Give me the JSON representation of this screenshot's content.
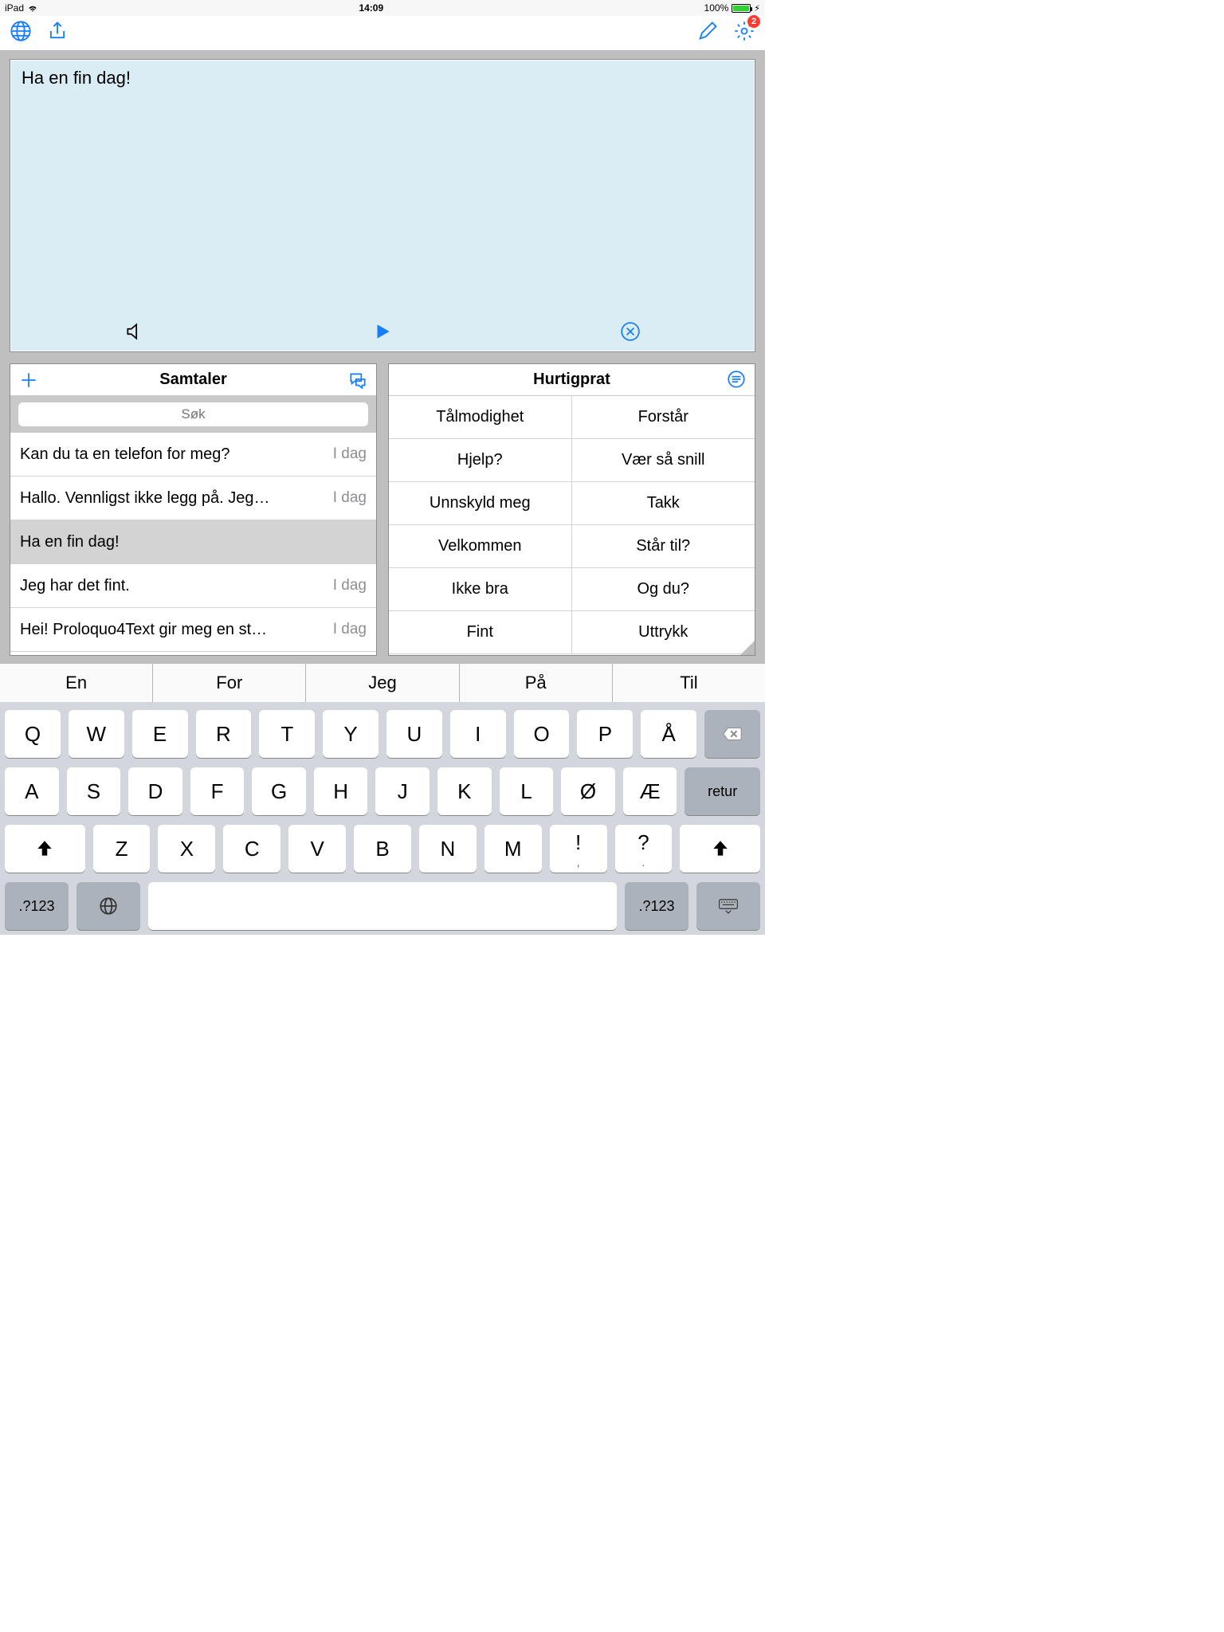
{
  "status": {
    "device": "iPad",
    "time": "14:09",
    "battery_pct": "100%"
  },
  "toolbar": {
    "badge_count": "2"
  },
  "compose": {
    "text": "Ha en fin dag!"
  },
  "conversations": {
    "title": "Samtaler",
    "search_placeholder": "Søk",
    "rows": [
      {
        "title": "Kan du ta en telefon for meg?",
        "when": "I dag"
      },
      {
        "title": "Hallo. Vennligst ikke legg på. Jeg…",
        "when": "I dag"
      },
      {
        "title": "Ha en fin dag!",
        "when": ""
      },
      {
        "title": "Jeg har det fint.",
        "when": "I dag"
      },
      {
        "title": "Hei! Proloquo4Text gir meg en st…",
        "when": "I dag"
      }
    ],
    "selected_index": 2
  },
  "quick": {
    "title": "Hurtigprat",
    "cells": [
      "Tålmodighet",
      "Forstår",
      "Hjelp?",
      "Vær så snill",
      "Unnskyld meg",
      "Takk",
      "Velkommen",
      "Står til?",
      "Ikke bra",
      "Og du?",
      "Fint",
      "Uttrykk"
    ]
  },
  "suggestions": [
    "En",
    "For",
    "Jeg",
    "På",
    "Til"
  ],
  "keyboard": {
    "row1": [
      "Q",
      "W",
      "E",
      "R",
      "T",
      "Y",
      "U",
      "I",
      "O",
      "P",
      "Å"
    ],
    "row2": [
      "A",
      "S",
      "D",
      "F",
      "G",
      "H",
      "J",
      "K",
      "L",
      "Ø",
      "Æ"
    ],
    "row3": [
      "Z",
      "X",
      "C",
      "V",
      "B",
      "N",
      "M"
    ],
    "punct1_top": "!",
    "punct1_bot": ",",
    "punct2_top": "?",
    "punct2_bot": ".",
    "return_label": "retur",
    "numlabel": ".?123"
  }
}
